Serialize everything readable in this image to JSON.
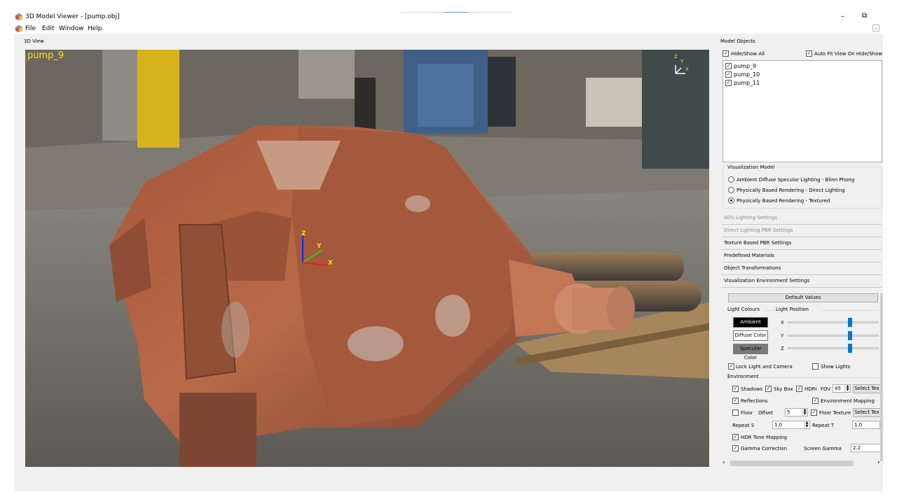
{
  "window": {
    "title": "3D Model Viewer - [pump.obj]",
    "minimize_glyph": "–",
    "maximize_glyph": "⧉",
    "restore_glyph": "–"
  },
  "menu": [
    "File",
    "Edit",
    "Window",
    "Help"
  ],
  "view": {
    "label": "3D View",
    "model_name": "pump_9",
    "gizmo": {
      "x": "X",
      "y": "Y",
      "z": "Z"
    },
    "corner_axes": {
      "x": "X",
      "y": "Y",
      "z": "Z"
    }
  },
  "panel": {
    "title": "Model Objects",
    "hide_show_all": {
      "label": "Hide/Show All",
      "checked": true
    },
    "auto_fit": {
      "label": "Auto Fit View On Hide/Show",
      "checked": true
    },
    "objects": [
      {
        "name": "pump_9",
        "checked": true
      },
      {
        "name": "pump_10",
        "checked": true
      },
      {
        "name": "pump_11",
        "checked": true
      }
    ],
    "visualization_model": {
      "title": "Visualization Model",
      "options": [
        "Ambient Diffuse Specular Lighting - Blinn Phong",
        "Physically Based Rendering - Direct Lighting",
        "Physically Based Rendering - Textured"
      ],
      "selected": 2
    },
    "sections": [
      {
        "label": "ADS Lighting Settings",
        "disabled": true
      },
      {
        "label": "Direct Lighting PBR Settings",
        "disabled": true
      },
      {
        "label": "Texture Based PBR Settings",
        "disabled": false
      },
      {
        "label": "Predefined Materials",
        "disabled": false
      },
      {
        "label": "Object Transformations",
        "disabled": false
      },
      {
        "label": "Visualization Environment Settings",
        "disabled": false
      }
    ],
    "env": {
      "default_values": "Default Values",
      "light_colours": "Light Colours",
      "light_position": "Light Position",
      "ambient": "Ambient Color",
      "diffuse": "Diffuse Color",
      "specular": "Specular Color",
      "ambient_color": "#000000",
      "diffuse_color": "#ffffff",
      "specular_color": "#7a7a7a",
      "axis_x": "X",
      "axis_y": "Y",
      "axis_z": "Z",
      "light_x": 0.72,
      "light_y": 0.72,
      "light_z": 0.72,
      "lock_light": "Lock Light and Camera",
      "show_lights": "Show Lights",
      "environment": "Environment",
      "shadows": "Shadows",
      "skybox": "Sky Box",
      "hdri": "HDRI",
      "fov_label": "FOV",
      "fov": "45",
      "select_tex": "Select Tex",
      "reflections": "Reflections",
      "env_mapping": "Environment Mapping",
      "floor": "Floor",
      "offset_label": "Offset",
      "offset": "5",
      "floor_texture": "Floor Texture",
      "select_tex2": "Select Tex",
      "repeat_s_label": "Repeat S",
      "repeat_s": "1.0",
      "repeat_t_label": "Repeat T",
      "repeat_t": "1.0",
      "hdr_tone": "HDR Tone Mapping",
      "gamma": "Gamma Correction",
      "screen_gamma_label": "Screen Gamma",
      "screen_gamma": "2.2"
    }
  },
  "colors": {
    "accent": "#0078d7",
    "label_yellow": "#ffe000"
  }
}
